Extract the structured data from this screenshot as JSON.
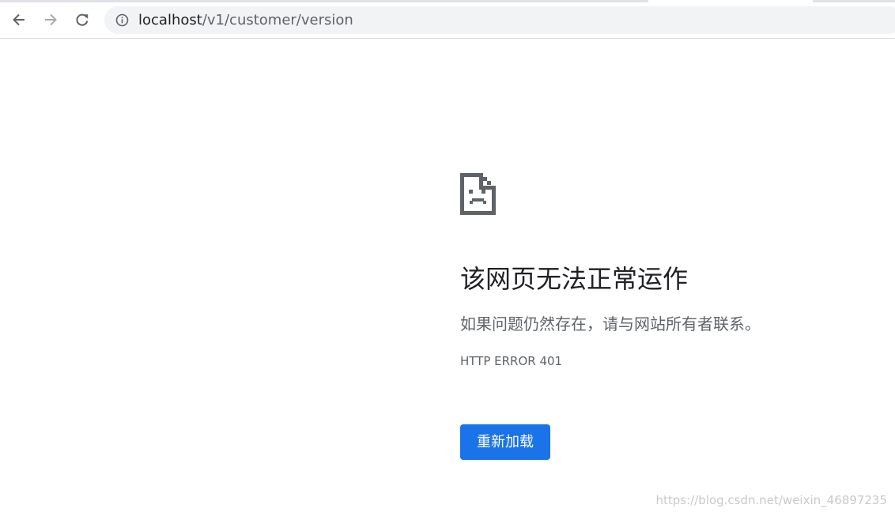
{
  "browser": {
    "url_host": "localhost",
    "url_path": "/v1/customer/version",
    "icons": {
      "back": "back-arrow-icon",
      "forward": "forward-arrow-icon",
      "reload": "reload-icon",
      "site_info": "info-icon"
    }
  },
  "error_page": {
    "icon": "sad-page-icon",
    "headline": "该网页无法正常运作",
    "suggestion": "如果问题仍然存在，请与网站所有者联系。",
    "error_code": "HTTP ERROR 401",
    "reload_button": "重新加载"
  },
  "watermark": "https://blog.csdn.net/weixin_46897235",
  "colors": {
    "accent": "#1a73e8",
    "text_primary": "#202124",
    "text_secondary": "#5f6368",
    "omnibox_bg": "#f1f3f4"
  }
}
